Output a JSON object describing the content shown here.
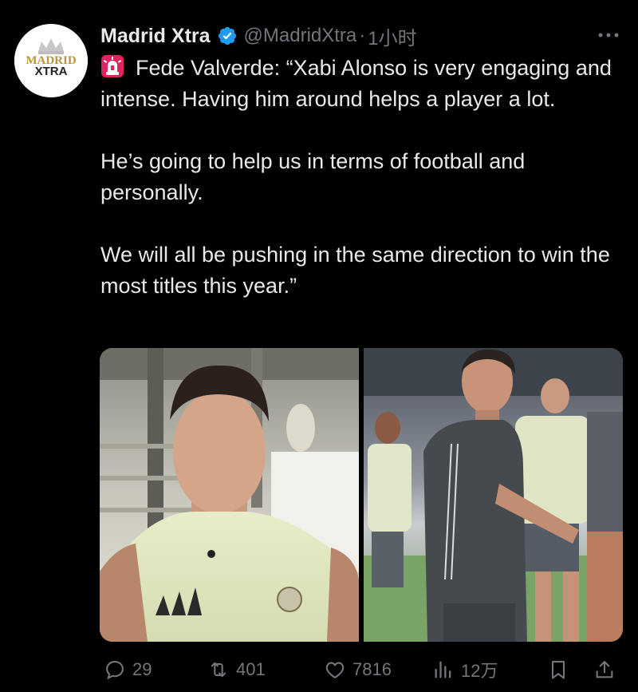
{
  "author": {
    "name": "Madrid Xtra",
    "handle": "@MadridXtra",
    "separator": "·",
    "time": "1小时",
    "avatar_line1": "MADRID",
    "avatar_line2": "XTRA",
    "verified": true
  },
  "tweet": {
    "line1": "Fede Valverde: “Xabi Alonso is very engaging and intense. Having him around helps a player a lot.",
    "line2": "He’s going to help us in terms of football and personally.",
    "line3": "We will all be pushing in the same direction to win the most titles this year.”"
  },
  "media": {
    "left_image": "photo of Fede Valverde in training top",
    "right_image": "photo of Xabi Alonso coaching players"
  },
  "actions": {
    "replies": "29",
    "retweets": "401",
    "likes": "7816",
    "views": "12万"
  },
  "colors": {
    "background": "#000000",
    "text": "#e7e9ea",
    "muted": "#71767b",
    "verified_blue": "#1d9bf0"
  }
}
